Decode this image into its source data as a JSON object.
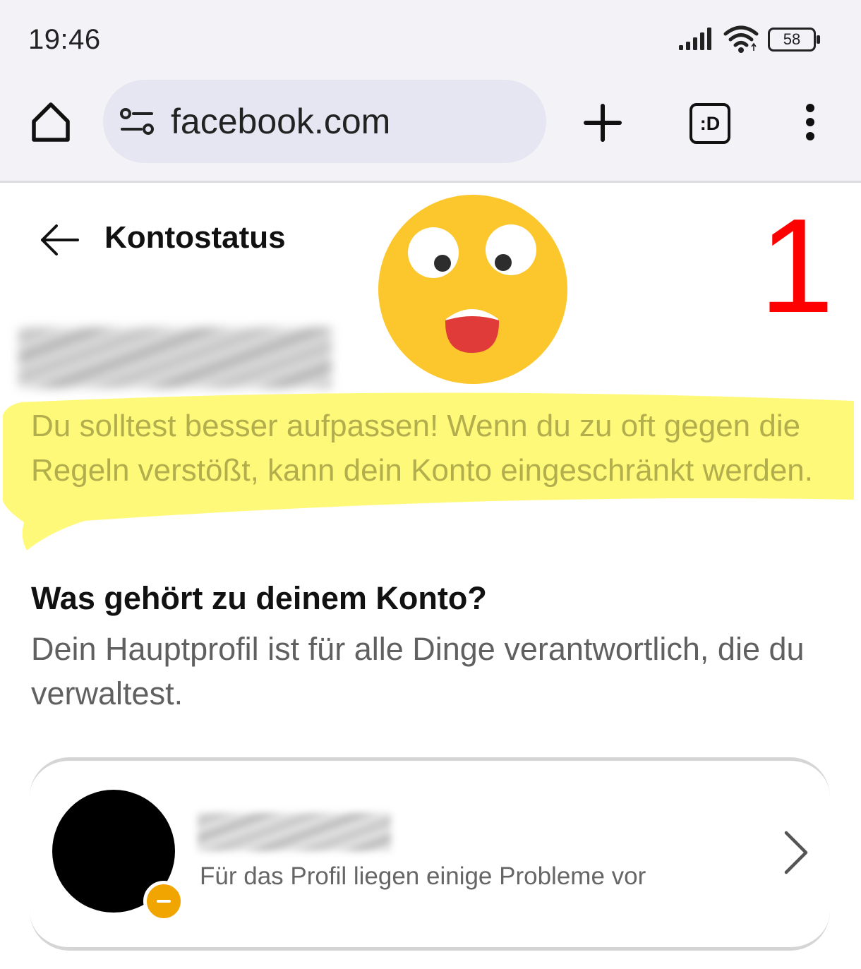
{
  "status_bar": {
    "time": "19:46",
    "battery": "58",
    "icons": [
      "signal-icon",
      "wifi-icon",
      "battery-icon"
    ]
  },
  "browser": {
    "url": "facebook.com",
    "tabs_label": ":D",
    "icons": [
      "home-icon",
      "site-settings-icon",
      "plus-icon",
      "tabs-icon",
      "more-vert-icon"
    ]
  },
  "page": {
    "title": "Kontostatus",
    "warning": "Du solltest besser aufpassen! Wenn du zu oft gegen die Regeln verstößt, kann dein Konto eingeschränkt werden.",
    "section_title": "Was gehört zu deinem Konto?",
    "section_desc": "Dein Hauptprofil ist für alle Dinge verantwortlich, die du verwaltest.",
    "profile_status": "Für das Profil liegen einige Probleme vor"
  },
  "annotation": {
    "number": "1",
    "color": "#ff0000",
    "highlight_color": "#fff86e"
  },
  "colors": {
    "warning_text": "#b2ad4d",
    "status_dot": "#f0a500",
    "emoji_face": "#fcc62d"
  }
}
